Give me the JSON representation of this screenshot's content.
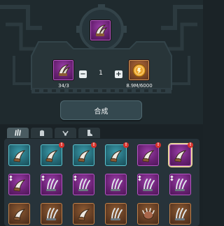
{
  "colors": {
    "panel_bg": "#1f2a2e",
    "machine": "#2c3a3f",
    "tier_teal": "#236673",
    "tier_purple": "#6a2174",
    "tier_orange": "#5f3a22",
    "badge": "#d8322b",
    "selected_outline": "#e8d29a"
  },
  "crafting": {
    "target_item_icon": "claw-icon",
    "material": {
      "icon": "claw-icon",
      "count_text": "34/3"
    },
    "coin": {
      "icon": "gold-coin-icon",
      "count_text": "8.9M/6000"
    },
    "quantity": {
      "minus_label": "−",
      "value": "1",
      "plus_label": "+"
    },
    "craft_button_label": "合成"
  },
  "inventory": {
    "tabs": [
      {
        "icon": "claw-icon",
        "active": true
      },
      {
        "icon": "glove-icon",
        "active": false
      },
      {
        "icon": "necklace-icon",
        "active": false
      },
      {
        "icon": "boot-icon",
        "active": false
      }
    ],
    "badge_label": "!",
    "rows": [
      [
        {
          "icon": "fang-icon",
          "tier": "teal",
          "badge": false
        },
        {
          "icon": "fang-icon",
          "tier": "teal",
          "badge": true
        },
        {
          "icon": "fang-icon",
          "tier": "teal",
          "badge": true
        },
        {
          "icon": "fang-icon",
          "tier": "teal",
          "badge": true
        },
        {
          "icon": "fang-icon",
          "tier": "purple",
          "badge": true
        },
        {
          "icon": "fang-icon",
          "tier": "purple",
          "badge": true,
          "selected": true
        }
      ],
      [
        {
          "icon": "fang-icon",
          "tier": "purple",
          "badge": false,
          "stars": 2
        },
        {
          "icon": "claw-icon",
          "tier": "purple",
          "badge": false,
          "stars": 2
        },
        {
          "icon": "claw-icon",
          "tier": "purple",
          "badge": false,
          "stars": 2
        },
        {
          "icon": "claw-icon",
          "tier": "purple",
          "badge": false
        },
        {
          "icon": "claw-icon",
          "tier": "purple",
          "badge": false,
          "stars": 2
        },
        {
          "icon": "claw-icon",
          "tier": "purple",
          "badge": false,
          "stars": 2
        }
      ],
      [
        {
          "icon": "fang-icon",
          "tier": "orange",
          "badge": false
        },
        {
          "icon": "claw-icon",
          "tier": "orange",
          "badge": false
        },
        {
          "icon": "fang-icon",
          "tier": "orange",
          "badge": false
        },
        {
          "icon": "claw-icon",
          "tier": "orange",
          "badge": false
        },
        {
          "icon": "paw-icon",
          "tier": "orange",
          "badge": false
        },
        {
          "icon": "claw-icon",
          "tier": "orange",
          "badge": false
        }
      ]
    ]
  }
}
